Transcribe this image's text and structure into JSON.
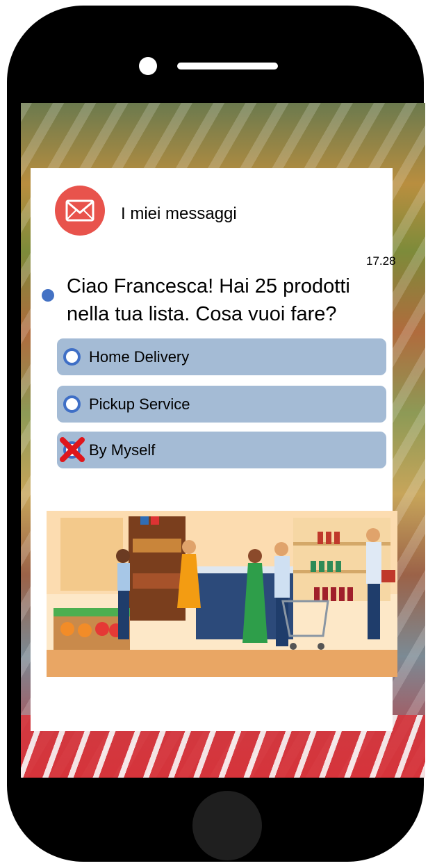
{
  "app": {
    "title": "I miei messaggi",
    "icon": "envelope-icon"
  },
  "message": {
    "time": "17.28",
    "text": "Ciao Francesca! Hai 25 prodotti nella tua lista. Cosa vuoi fare?"
  },
  "options": [
    {
      "label": "Home Delivery",
      "state": "unselected"
    },
    {
      "label": "Pickup Service",
      "state": "unselected"
    },
    {
      "label": "By Myself",
      "state": "crossed-out"
    }
  ],
  "colors": {
    "accent": "#e8534c",
    "option_background": "#a4bbd5",
    "radio": "#3f6fc6",
    "cross": "#e0161b",
    "unread_dot": "#4472c4"
  },
  "illustration": {
    "subject": "supermarket-shopping-illustration"
  }
}
